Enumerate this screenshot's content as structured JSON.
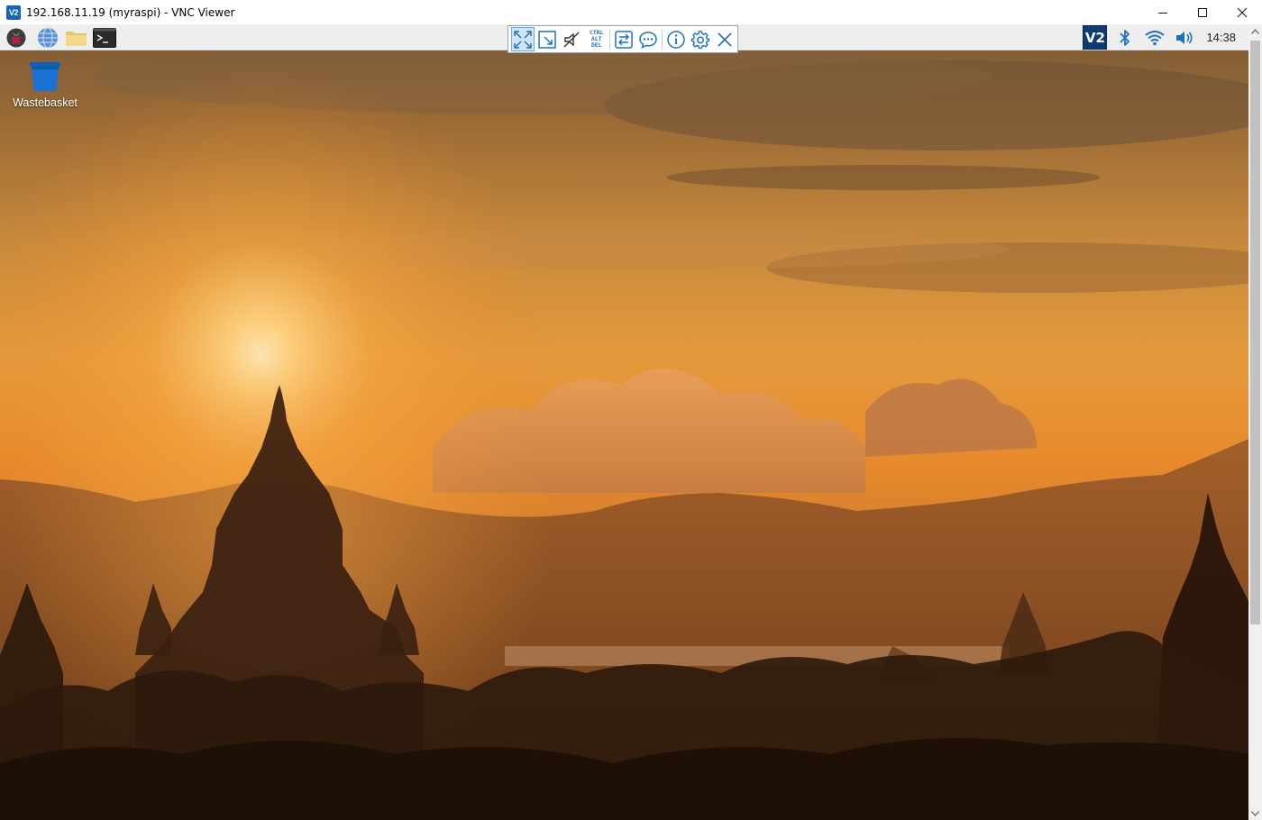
{
  "window": {
    "app_icon_text": "V2",
    "title": "192.168.11.19 (myraspi) - VNC Viewer",
    "controls": {
      "minimize": "—",
      "maximize": "☐",
      "close": "✕"
    }
  },
  "pi_panel": {
    "launchers": [
      {
        "name": "raspberry-menu-icon"
      },
      {
        "name": "web-browser-icon"
      },
      {
        "name": "file-manager-icon"
      },
      {
        "name": "terminal-icon"
      }
    ],
    "tray": {
      "vnc_server_icon_text": "V2",
      "clock": "14:38"
    }
  },
  "vnc_toolbar": {
    "ctrl_alt_del": [
      "CTRL",
      "ALT",
      "DEL"
    ]
  },
  "desktop": {
    "wastebasket_label": "Wastebasket"
  },
  "colors": {
    "accent": "#1565c0",
    "panel_bg": "#eeeeee",
    "toolbar_icon": "#1e73be"
  }
}
